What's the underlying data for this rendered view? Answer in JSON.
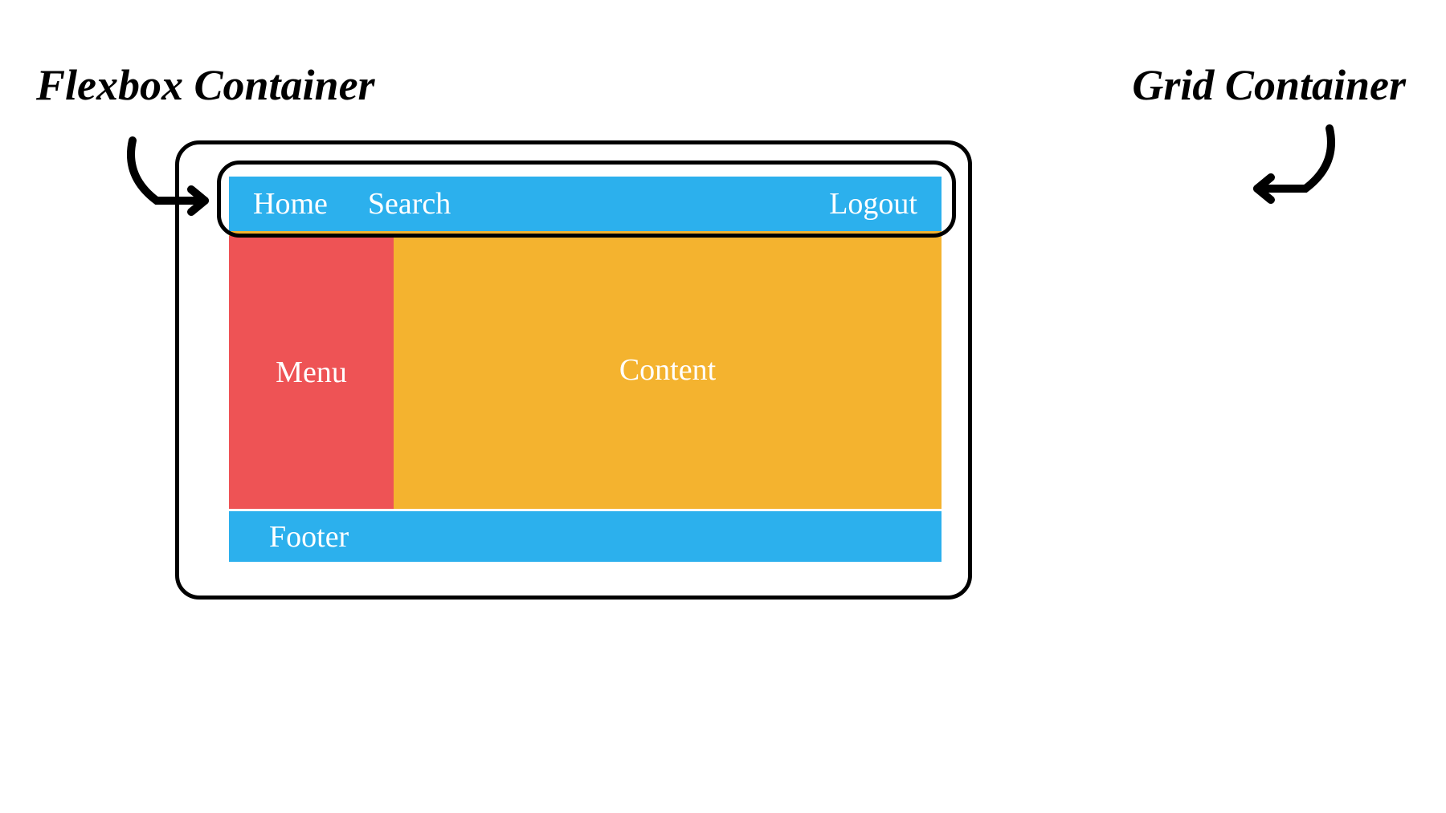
{
  "labels": {
    "flexbox": "Flexbox Container",
    "grid": "Grid Container"
  },
  "header": {
    "home": "Home",
    "search": "Search",
    "logout": "Logout"
  },
  "menu": {
    "label": "Menu"
  },
  "content": {
    "label": "Content"
  },
  "footer": {
    "label": "Footer"
  },
  "colors": {
    "blue": "#2cb0ed",
    "red": "#ee5355",
    "orange": "#f4b32f"
  }
}
